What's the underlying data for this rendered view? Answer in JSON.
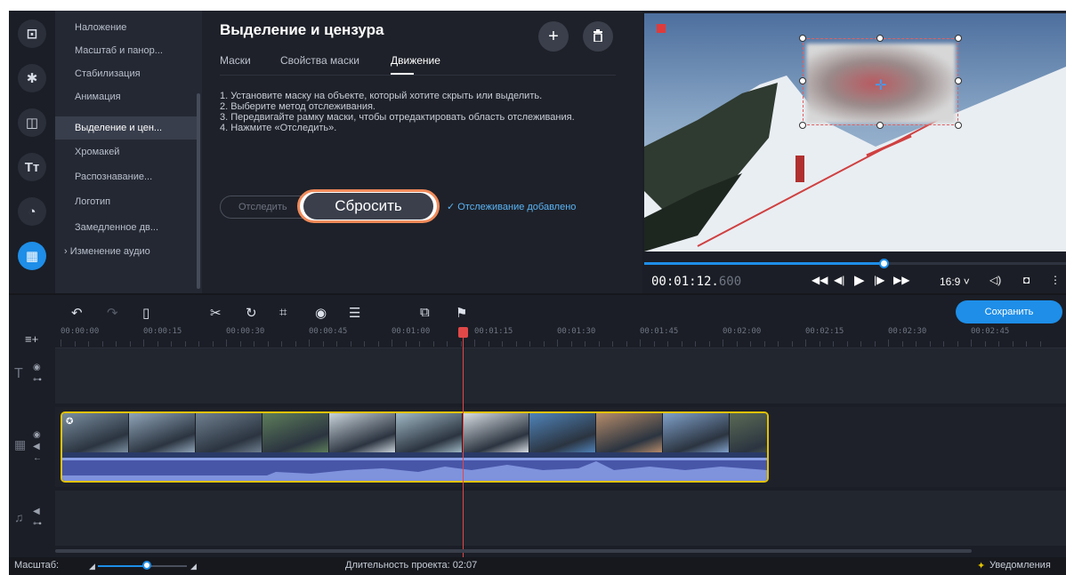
{
  "sidebar": {
    "items": [
      {
        "label": "Наложение"
      },
      {
        "label": "Масштаб и панор..."
      },
      {
        "label": "Стабилизация"
      },
      {
        "label": "Анимация"
      },
      {
        "label": "Выделение и цен..."
      },
      {
        "label": "Хромакей"
      },
      {
        "label": "Распознавание..."
      },
      {
        "label": "Логотип"
      },
      {
        "label": "Замедленное дв..."
      },
      {
        "label": "› Изменение аудио"
      }
    ],
    "active_index": 4
  },
  "iconbar": {
    "icons": [
      "import-icon",
      "effects-icon",
      "transitions-icon",
      "titles-icon",
      "stickers-icon",
      "more-tools-icon"
    ]
  },
  "panel": {
    "title": "Выделение и цензура",
    "add_symbol": "+",
    "delete_symbol": "🗑",
    "tabs": [
      {
        "label": "Маски"
      },
      {
        "label": "Свойства маски"
      },
      {
        "label": "Движение"
      }
    ],
    "active_tab": 2,
    "instructions": [
      "1. Установите маску на объекте, который хотите скрыть или выделить.",
      "2. Выберите метод отслеживания.",
      "3. Передвигайте рамку маски, чтобы отредактировать область отслеживания.",
      "4. Нажмите «Отследить»."
    ],
    "track_label": "Отследить",
    "reset_label": "Сбросить",
    "status": "✓ Отслеживание добавлено"
  },
  "player": {
    "timecode_main": "00:01:12.",
    "timecode_ms": "600",
    "aspect": "16:9 ˅",
    "progress": 0.57
  },
  "timeline": {
    "save_label": "Сохранить",
    "ruler": [
      "00:00:00",
      "00:00:15",
      "00:00:30",
      "00:00:45",
      "00:01:00",
      "00:01:15",
      "00:01:30",
      "00:01:45",
      "00:02:00",
      "00:02:15",
      "00:02:30",
      "00:02:45"
    ],
    "thumb_colors": [
      "#7a8ea0",
      "#8fa4b8",
      "#6f7f8f",
      "#5d7d5a",
      "#c9d3da",
      "#9fb8c4",
      "#d8dde2",
      "#4f83b9",
      "#b58b6a",
      "#7fa0c9",
      "#5a6a55"
    ]
  },
  "status": {
    "zoom_label": "Масштаб:",
    "zoom_level": 0.55,
    "duration": "Длительность проекта: 02:07",
    "notifications": "Уведомления"
  }
}
